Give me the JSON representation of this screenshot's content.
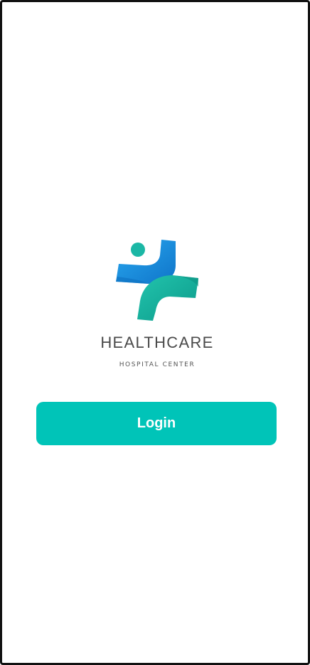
{
  "brand": {
    "name": "HEALTHCARE",
    "tagline": "HOSPITAL CENTER",
    "logo_icon": "medical-cross-person-icon",
    "colors": {
      "blue": "#1a8fe0",
      "teal": "#17b6a4"
    }
  },
  "login": {
    "label": "Login",
    "color": "#00c4b8"
  }
}
